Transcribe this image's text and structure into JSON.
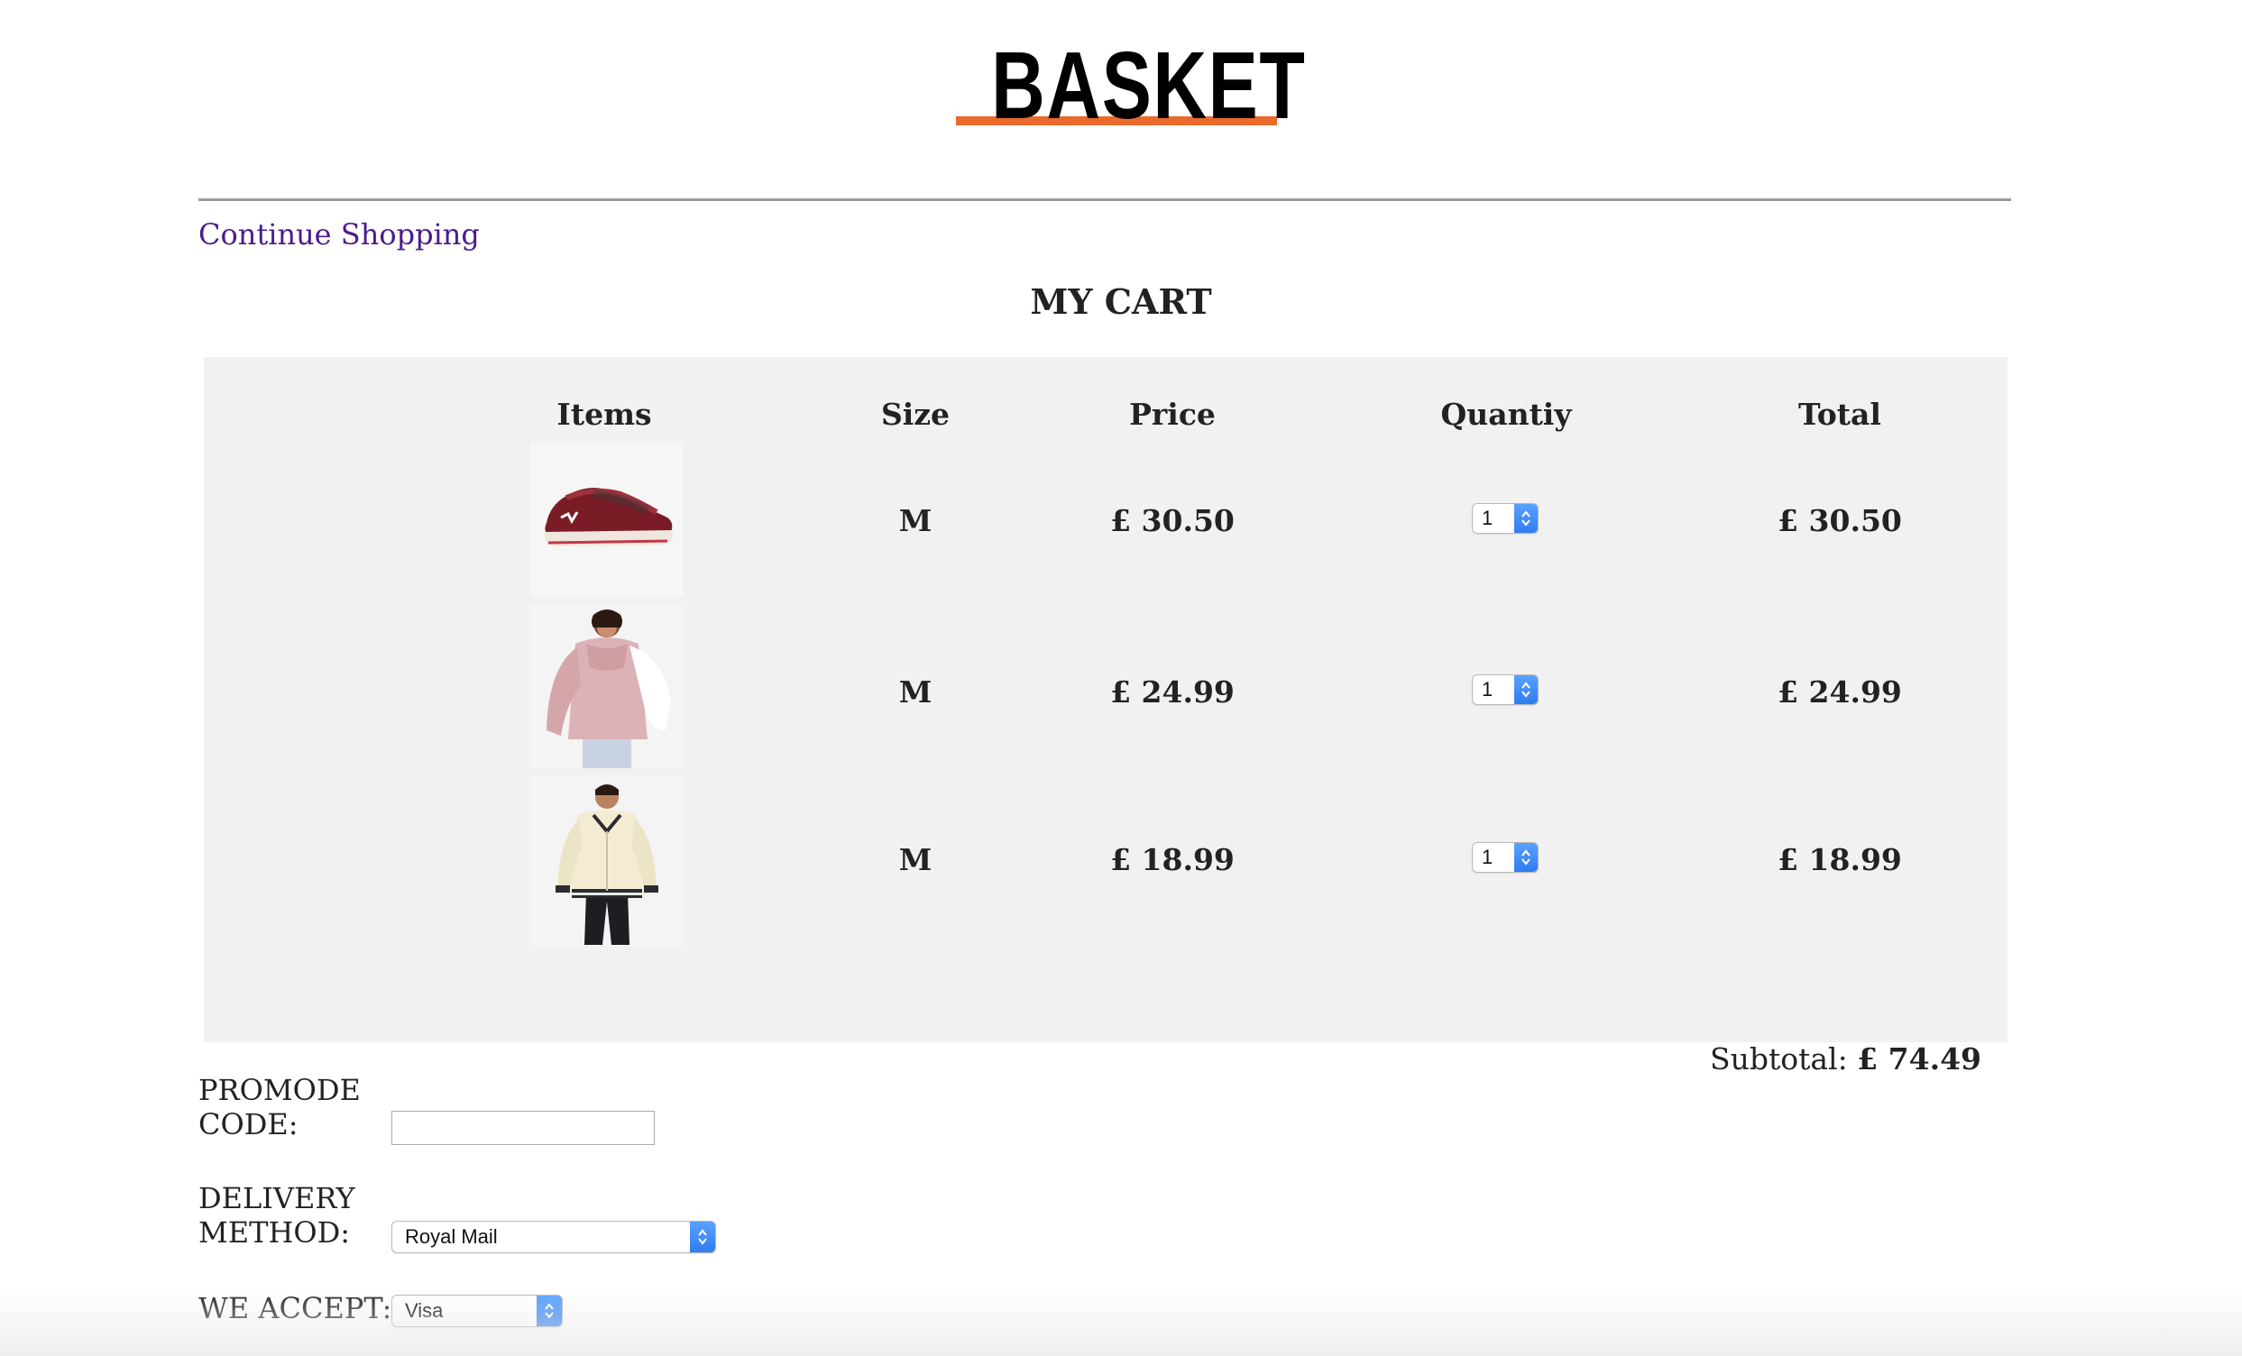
{
  "header": {
    "logo_text": "BASKET",
    "accent_color": "#ea6a2c"
  },
  "nav": {
    "continue_label": "Continue Shopping"
  },
  "cart": {
    "title": "MY CART",
    "columns": [
      "Items",
      "Size",
      "Price",
      "Quantiy",
      "Total"
    ],
    "rows": [
      {
        "item_icon": "red-running-shoe",
        "size": "M",
        "price": "£ 30.50",
        "quantity": "1",
        "total": "£ 30.50"
      },
      {
        "item_icon": "pink-hoodie",
        "size": "M",
        "price": "£ 24.99",
        "quantity": "1",
        "total": "£ 24.99"
      },
      {
        "item_icon": "cream-bomber-jacket",
        "size": "M",
        "price": "£ 18.99",
        "quantity": "1",
        "total": "£ 18.99"
      }
    ],
    "subtotal_label": "Subtotal:",
    "subtotal_value": "£ 74.49"
  },
  "form": {
    "promo_label_line1": "PROMODE",
    "promo_label_line2": "CODE:",
    "promo_value": "",
    "delivery_label_line1": "DELIVERY",
    "delivery_label_line2": "METHOD:",
    "delivery_selected": "Royal Mail",
    "payment_label": "WE ACCEPT:",
    "payment_selected": "Visa"
  }
}
